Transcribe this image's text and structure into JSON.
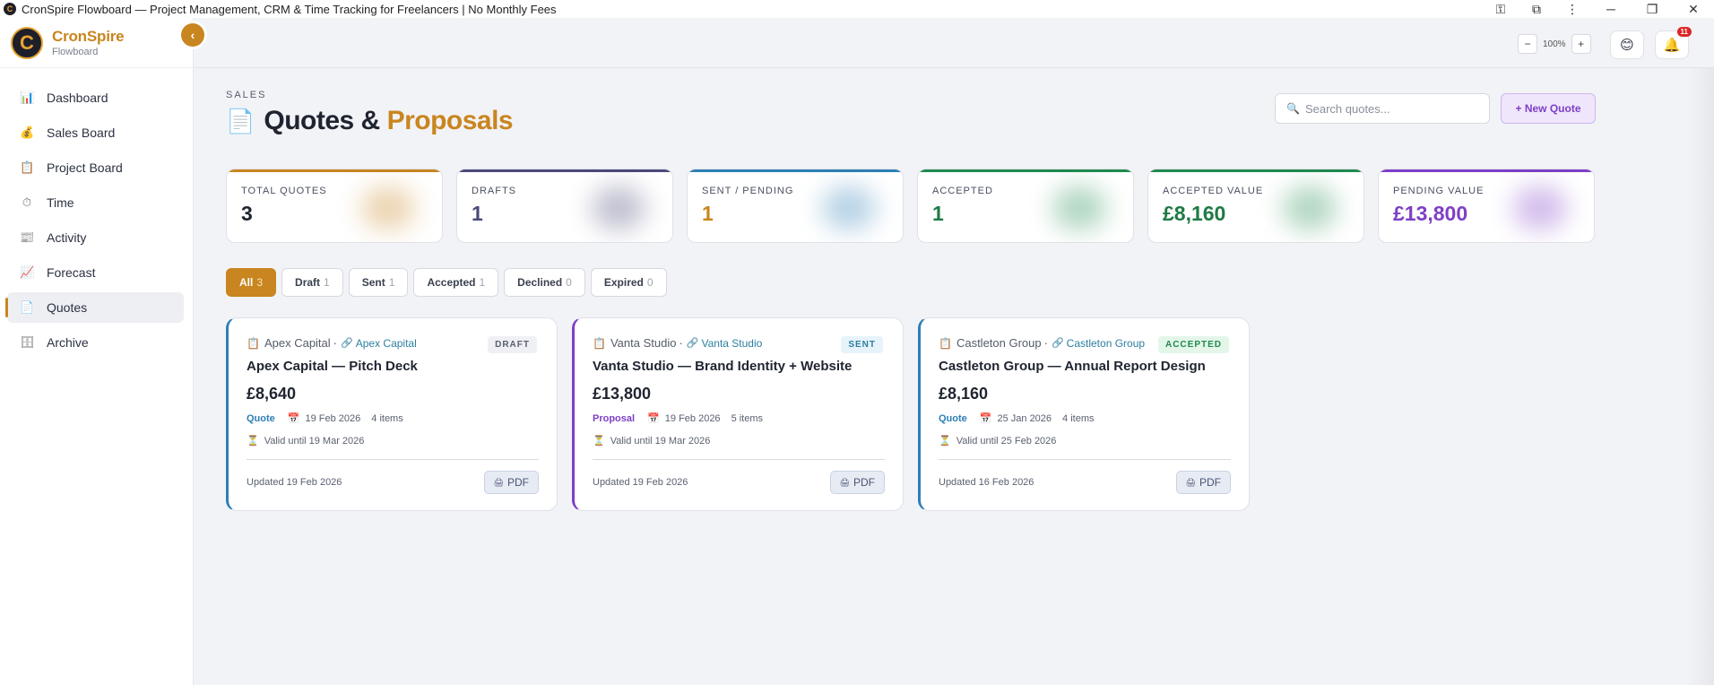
{
  "window": {
    "title": "CronSpire Flowboard — Project Management, CRM & Time Tracking for Freelancers | No Monthly Fees"
  },
  "brand": {
    "name_part1": "Cron",
    "name_part2": "Spire",
    "subtitle": "Flowboard"
  },
  "sidebar": {
    "items": [
      {
        "label": "Dashboard",
        "icon": "bar-chart-icon",
        "glyph": "📊"
      },
      {
        "label": "Sales Board",
        "icon": "money-bag-icon",
        "glyph": "💰"
      },
      {
        "label": "Project Board",
        "icon": "clipboard-icon",
        "glyph": "📋"
      },
      {
        "label": "Time",
        "icon": "stopwatch-icon",
        "glyph": "⏱"
      },
      {
        "label": "Activity",
        "icon": "newspaper-icon",
        "glyph": "📰"
      },
      {
        "label": "Forecast",
        "icon": "trend-up-icon",
        "glyph": "📈"
      },
      {
        "label": "Quotes",
        "icon": "document-icon",
        "glyph": "📄"
      },
      {
        "label": "Archive",
        "icon": "archive-icon",
        "glyph": "🗄"
      }
    ],
    "active_label": "Quotes"
  },
  "topbar": {
    "zoom_minus": "−",
    "zoom_value": "100%",
    "zoom_plus": "+",
    "notification_count": "11"
  },
  "page": {
    "eyebrow": "SALES",
    "title_part1": "Quotes & ",
    "title_part2": "Proposals",
    "search_placeholder": "Search quotes...",
    "new_quote_label": "+ New Quote"
  },
  "stats": [
    {
      "label": "TOTAL QUOTES",
      "value": "3",
      "color": "#c9851f",
      "value_color": "#1f2430"
    },
    {
      "label": "DRAFTS",
      "value": "1",
      "color": "#4b4a7a",
      "value_color": "#4b4a7a"
    },
    {
      "label": "SENT / PENDING",
      "value": "1",
      "color": "#2d7fb5",
      "value_color": "#c9851f"
    },
    {
      "label": "ACCEPTED",
      "value": "1",
      "color": "#1f8a4c",
      "value_color": "#1f7a44"
    },
    {
      "label": "ACCEPTED VALUE",
      "value": "£8,160",
      "color": "#1f8a4c",
      "value_color": "#1f7a44"
    },
    {
      "label": "PENDING VALUE",
      "value": "£13,800",
      "color": "#7e3fc6",
      "value_color": "#7e3fc6"
    }
  ],
  "filters": [
    {
      "label": "All",
      "count": "3"
    },
    {
      "label": "Draft",
      "count": "1"
    },
    {
      "label": "Sent",
      "count": "1"
    },
    {
      "label": "Accepted",
      "count": "1"
    },
    {
      "label": "Declined",
      "count": "0"
    },
    {
      "label": "Expired",
      "count": "0"
    }
  ],
  "cards": [
    {
      "client": "Apex Capital",
      "sep": "·",
      "client_link": "Apex Capital",
      "badge": "DRAFT",
      "title": "Apex Capital — Pitch Deck",
      "amount": "£8,640",
      "type": "Quote",
      "date": "19 Feb 2026",
      "items": "4 items",
      "valid": "Valid until 19 Mar 2026",
      "updated": "Updated 19 Feb 2026",
      "pdf_label": "PDF",
      "accent": "#2d7fb5",
      "type_color": "#2d7fb5"
    },
    {
      "client": "Vanta Studio",
      "sep": "·",
      "client_link": "Vanta Studio",
      "badge": "SENT",
      "title": "Vanta Studio — Brand Identity + Website",
      "amount": "£13,800",
      "type": "Proposal",
      "date": "19 Feb 2026",
      "items": "5 items",
      "valid": "Valid until 19 Mar 2026",
      "updated": "Updated 19 Feb 2026",
      "pdf_label": "PDF",
      "accent": "#7e3fc6",
      "type_color": "#7e3fc6"
    },
    {
      "client": "Castleton Group",
      "sep": "·",
      "client_link": "Castleton Group",
      "badge": "ACCEPTED",
      "title": "Castleton Group — Annual Report Design",
      "amount": "£8,160",
      "type": "Quote",
      "date": "25 Jan 2026",
      "items": "4 items",
      "valid": "Valid until 25 Feb 2026",
      "updated": "Updated 16 Feb 2026",
      "pdf_label": "PDF",
      "accent": "#2d7fb5",
      "type_color": "#2d7fb5"
    }
  ]
}
